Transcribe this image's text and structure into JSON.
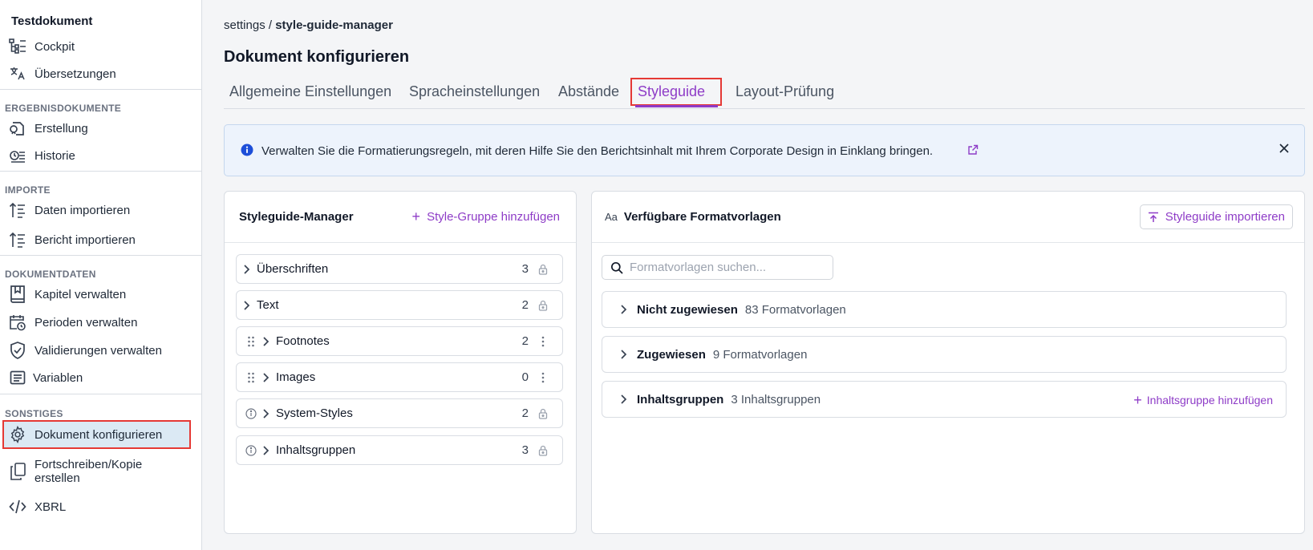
{
  "sidebar": {
    "doc_title": "Testdokument",
    "top_items": [
      {
        "label": "Cockpit",
        "icon": "cockpit-icon"
      },
      {
        "label": "Übersetzungen",
        "icon": "translate-icon"
      }
    ],
    "sections": [
      {
        "label": "ERGEBNISDOKUMENTE",
        "items": [
          {
            "label": "Erstellung",
            "icon": "document-create-icon"
          },
          {
            "label": "Historie",
            "icon": "history-icon"
          }
        ]
      },
      {
        "label": "IMPORTE",
        "items": [
          {
            "label": "Daten importieren",
            "icon": "import-data-icon"
          },
          {
            "label": "Bericht importieren",
            "icon": "import-report-icon"
          }
        ]
      },
      {
        "label": "DOKUMENTDATEN",
        "items": [
          {
            "label": "Kapitel verwalten",
            "icon": "book-icon"
          },
          {
            "label": "Perioden verwalten",
            "icon": "calendar-icon"
          },
          {
            "label": "Validierungen verwalten",
            "icon": "shield-check-icon"
          },
          {
            "label": "Variablen",
            "icon": "variables-icon"
          }
        ]
      },
      {
        "label": "SONSTIGES",
        "items": [
          {
            "label": "Dokument konfigurieren",
            "icon": "gear-icon",
            "active": true
          },
          {
            "label": "Fortschreiben/Kopie erstellen",
            "icon": "copy-icon"
          },
          {
            "label": "XBRL",
            "icon": "code-icon"
          }
        ]
      }
    ]
  },
  "breadcrumb": {
    "parent": "settings",
    "separator": "/",
    "current": "style-guide-manager"
  },
  "page_title": "Dokument konfigurieren",
  "tabs": [
    {
      "label": "Allgemeine Einstellungen"
    },
    {
      "label": "Spracheinstellungen"
    },
    {
      "label": "Abstände"
    },
    {
      "label": "Styleguide",
      "active": true
    },
    {
      "label": "Layout-Prüfung"
    }
  ],
  "banner": {
    "text": "Verwalten Sie die Formatierungsregeln, mit deren Hilfe Sie den Berichtsinhalt mit Ihrem Corporate Design in Einklang bringen.",
    "icon": "info-icon",
    "link_icon": "external-link-icon",
    "close_icon": "close-icon"
  },
  "manager": {
    "title": "Styleguide-Manager",
    "add_label": "Style-Gruppe hinzufügen",
    "groups": [
      {
        "name": "Überschriften",
        "count": "3",
        "lead": "",
        "tail": "lock"
      },
      {
        "name": "Text",
        "count": "2",
        "lead": "",
        "tail": "lock"
      },
      {
        "name": "Footnotes",
        "count": "2",
        "lead": "drag",
        "tail": "more"
      },
      {
        "name": "Images",
        "count": "0",
        "lead": "drag",
        "tail": "more"
      },
      {
        "name": "System-Styles",
        "count": "2",
        "lead": "info",
        "tail": "lock"
      },
      {
        "name": "Inhaltsgruppen",
        "count": "3",
        "lead": "info",
        "tail": "lock"
      }
    ]
  },
  "templates": {
    "title": "Verfügbare Formatvorlagen",
    "title_icon": "Aa",
    "import_label": "Styleguide importieren",
    "search_placeholder": "Formatvorlagen suchen...",
    "sections": [
      {
        "name": "Nicht zugewiesen",
        "sub": "83 Formatvorlagen"
      },
      {
        "name": "Zugewiesen",
        "sub": "9 Formatvorlagen"
      },
      {
        "name": "Inhaltsgruppen",
        "sub": "3 Inhaltsgruppen",
        "action": "Inhaltsgruppe hinzufügen"
      }
    ]
  },
  "colors": {
    "accent": "#8e3cc7",
    "highlight": "#e53935",
    "active_bg": "#dbe9f4",
    "info": "#1d4ed8"
  }
}
